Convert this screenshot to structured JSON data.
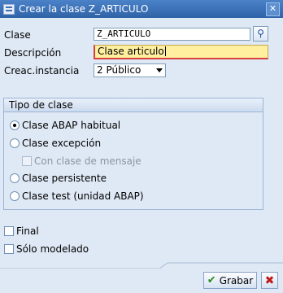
{
  "window": {
    "title": "Crear la clase Z_ARTICULO"
  },
  "form": {
    "clase_label": "Clase",
    "clase_value": "Z_ARTICULO",
    "descripcion_label": "Descripción",
    "descripcion_value": "Clase articulo",
    "instancia_label": "Creac.instancia",
    "instancia_value": "2 Público"
  },
  "tipo_clase": {
    "title": "Tipo de clase",
    "options": [
      {
        "label": "Clase ABAP habitual",
        "checked": true
      },
      {
        "label": "Clase excepción",
        "checked": false
      },
      {
        "label": "Con clase de mensaje",
        "checked": false,
        "disabled": true
      },
      {
        "label": "Clase persistente",
        "checked": false
      },
      {
        "label": "Clase test (unidad ABAP)",
        "checked": false
      }
    ]
  },
  "flags": {
    "final_label": "Final",
    "solo_modelado_label": "Sólo modelado"
  },
  "buttons": {
    "grabar_label": "Grabar"
  },
  "colors": {
    "title_bar": "#2f63a8",
    "background": "#dfe9f5",
    "active_field": "#ffef9f",
    "required_mark": "#d64040"
  },
  "icons": {
    "window": "app-window-icon",
    "close": "close-icon",
    "help": "possible-entries-icon",
    "save": "checkmark-icon",
    "cancel": "cancel-x-icon"
  }
}
